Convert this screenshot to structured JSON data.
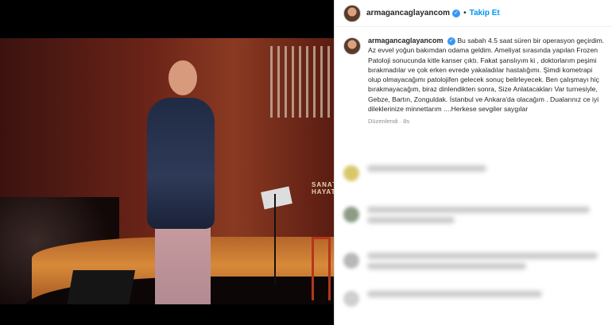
{
  "post": {
    "header": {
      "username": "armagancaglayancom",
      "separator": "•",
      "follow_label": "Takip Et",
      "verified_glyph": "✓"
    },
    "caption": {
      "username": "armagancaglayancom",
      "verified_glyph": "✓",
      "text": "Bu sabah 4.5 saat süren bir operasyon geçirdim. Az evvel yoğun bakımdan odama geldim. Ameliyat sırasında yapılan Frozen Patoloji sonucunda kitle kanser çıktı. Fakat şanslıyım ki , doktorlarım peşimi bırakmadılar ve çok erken evrede yakaladılar hastalığımı. Şimdi kometrapi olup olmayacağımı patolojifen gelecek sonuç belirleyecek. Ben çalışmayı hiç bırakmayacağım, biraz dinlendikten sonra, Size Anlatacakları Var turnesiyle, Gebze, Bartın, Zonguldak. İstanbul ve Ankara'da olacağım . Dualarınız ce iyi dileklerinize minnettarım ....Herkese sevgiler saygılar",
      "edited_label": "Düzenlendi · 8s"
    },
    "photo": {
      "wall_sign": "SANAT HAYAT"
    }
  },
  "icons": {
    "verified": "verified-badge-icon"
  },
  "colors": {
    "accent": "#0095f6",
    "verified": "#3897f0",
    "text": "#262626",
    "muted": "#8e8e8e"
  }
}
